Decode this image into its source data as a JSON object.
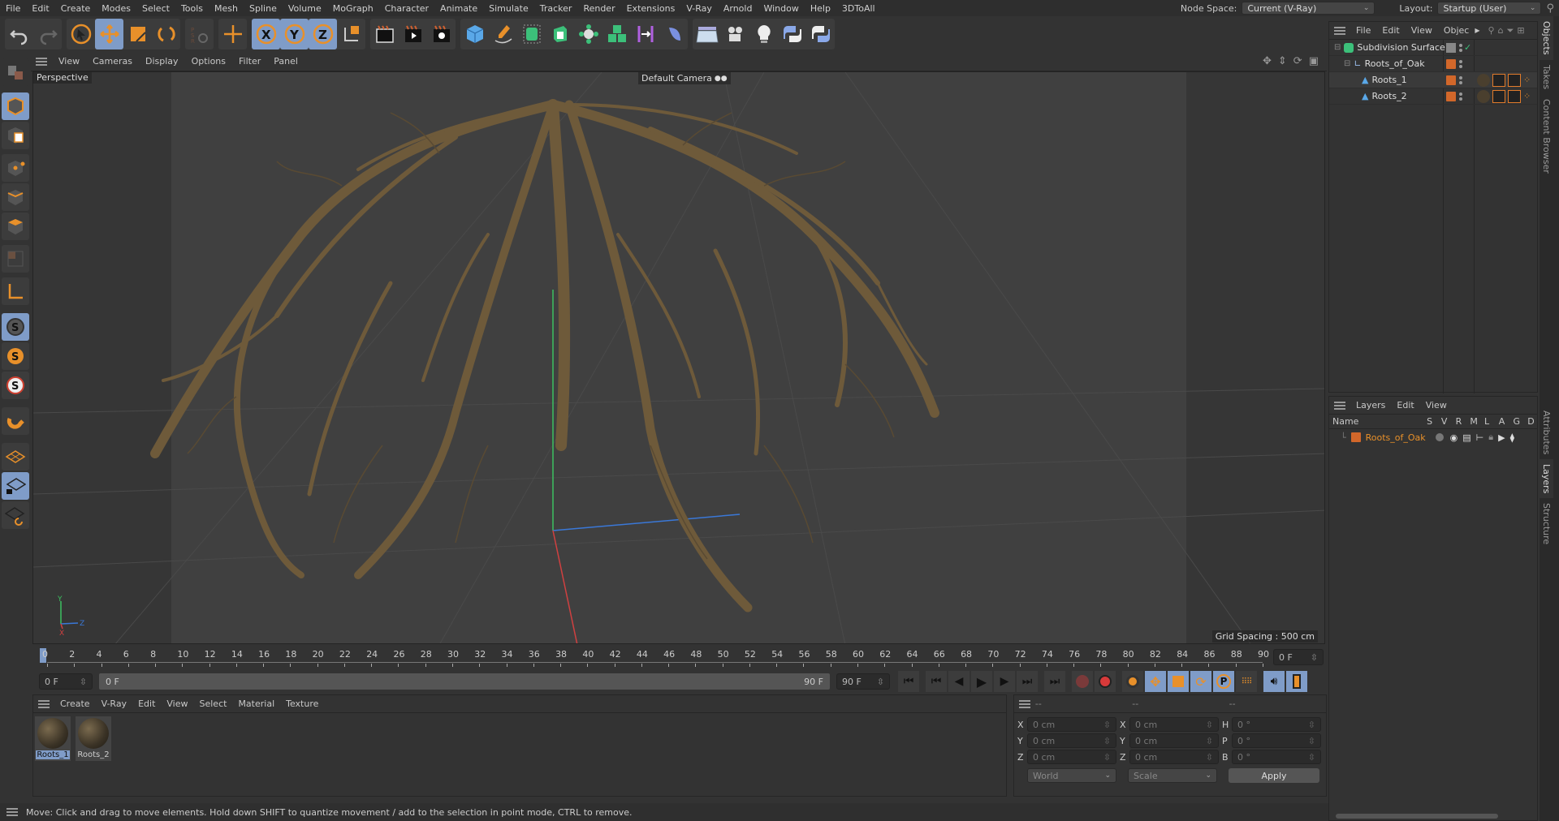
{
  "menubar": {
    "items": [
      "File",
      "Edit",
      "Create",
      "Modes",
      "Select",
      "Tools",
      "Mesh",
      "Spline",
      "Volume",
      "MoGraph",
      "Character",
      "Animate",
      "Simulate",
      "Tracker",
      "Render",
      "Extensions",
      "V-Ray",
      "Arnold",
      "Window",
      "Help",
      "3DToAll"
    ],
    "node_space_label": "Node Space:",
    "node_space_value": "Current (V-Ray)",
    "layout_label": "Layout:",
    "layout_value": "Startup (User)"
  },
  "toolbar": {
    "groups": [
      [
        "undo-icon",
        "redo-icon"
      ],
      [
        "select-arrow-icon",
        "move-icon",
        "scale-icon",
        "rotate-icon"
      ],
      [
        "psr-icon"
      ],
      [
        "world-axis-icon"
      ],
      [
        "x-axis-icon",
        "y-axis-icon",
        "z-axis-icon",
        "coordinate-system-icon"
      ],
      [
        "render-view-icon",
        "render-picture-viewer-icon",
        "render-settings-icon"
      ],
      [
        "cube-icon",
        "pen-icon",
        "subdivision-icon",
        "extrude-icon",
        "mograph-cloner-icon",
        "generator-icon",
        "deformer-icon",
        "field-icon"
      ],
      [
        "floor-icon",
        "camera-icon",
        "light-icon",
        "python-icon",
        "python-alt-icon"
      ]
    ]
  },
  "left_tools": [
    "make-editable-icon",
    "model-mode-icon",
    "texture-mode-icon",
    "point-mode-icon",
    "edge-mode-icon",
    "polygon-mode-icon",
    "uv-mode-icon",
    "axis-mode-icon",
    "solo-off-icon",
    "solo-single-icon",
    "solo-hierarchy-icon",
    "snap-icon",
    "workplane-icon",
    "locked-workplane-icon",
    "planar-workplane-icon"
  ],
  "viewport": {
    "menu": [
      "View",
      "Cameras",
      "Display",
      "Options",
      "Filter",
      "Panel"
    ],
    "view_name": "Perspective",
    "camera": "Default Camera",
    "grid_spacing": "Grid Spacing : 500 cm",
    "axis": {
      "x": "X",
      "y": "Y",
      "z": "Z"
    },
    "colors": {
      "x": "#d04040",
      "y": "#3cc060",
      "z": "#3a78d8"
    }
  },
  "timeline": {
    "ticks": [
      "0",
      "2",
      "4",
      "6",
      "8",
      "10",
      "12",
      "14",
      "16",
      "18",
      "20",
      "22",
      "24",
      "26",
      "28",
      "30",
      "32",
      "34",
      "36",
      "38",
      "40",
      "42",
      "44",
      "46",
      "48",
      "50",
      "52",
      "54",
      "56",
      "58",
      "60",
      "62",
      "64",
      "66",
      "68",
      "70",
      "72",
      "74",
      "76",
      "78",
      "80",
      "82",
      "84",
      "86",
      "88",
      "90"
    ],
    "current_frame": "0 F",
    "start_frame": "0 F",
    "range_start": "0 F",
    "range_end": "90 F",
    "end_frame": "90 F"
  },
  "materials": {
    "menu": [
      "Create",
      "V-Ray",
      "Edit",
      "View",
      "Select",
      "Material",
      "Texture"
    ],
    "items": [
      {
        "name": "Roots_1",
        "selected": true
      },
      {
        "name": "Roots_2",
        "selected": false
      }
    ]
  },
  "coordinates": {
    "headers": [
      "--",
      "--",
      "--"
    ],
    "rows": [
      {
        "l1": "X",
        "v1": "0 cm",
        "l2": "X",
        "v2": "0 cm",
        "l3": "H",
        "v3": "0 °"
      },
      {
        "l1": "Y",
        "v1": "0 cm",
        "l2": "Y",
        "v2": "0 cm",
        "l3": "P",
        "v3": "0 °"
      },
      {
        "l1": "Z",
        "v1": "0 cm",
        "l2": "Z",
        "v2": "0 cm",
        "l3": "B",
        "v3": "0 °"
      }
    ],
    "mode": "World",
    "transform": "Scale",
    "apply": "Apply"
  },
  "status": "Move: Click and drag to move elements. Hold down SHIFT to quantize movement / add to the selection in point mode, CTRL to remove.",
  "objects": {
    "menu": [
      "File",
      "Edit",
      "View",
      "Objec"
    ],
    "items": [
      {
        "name": "Subdivision Surface",
        "indent": 0,
        "icon": "subdivision-surface-icon"
      },
      {
        "name": "Roots_of_Oak",
        "indent": 1,
        "icon": "null-object-icon"
      },
      {
        "name": "Roots_1",
        "indent": 2,
        "icon": "polygon-object-icon"
      },
      {
        "name": "Roots_2",
        "indent": 2,
        "icon": "polygon-object-icon"
      }
    ],
    "layer_color": "#d2672a"
  },
  "layers": {
    "menu": [
      "Layers",
      "Edit",
      "View"
    ],
    "columns": [
      "Name",
      "S",
      "V",
      "R",
      "M",
      "L",
      "A",
      "G",
      "D"
    ],
    "items": [
      {
        "name": "Roots_of_Oak",
        "color": "#d2672a"
      }
    ]
  },
  "side_tabs": {
    "top": [
      "Objects",
      "Takes",
      "Content Browser"
    ],
    "bottom": [
      "Attributes",
      "Layers",
      "Structure"
    ]
  }
}
